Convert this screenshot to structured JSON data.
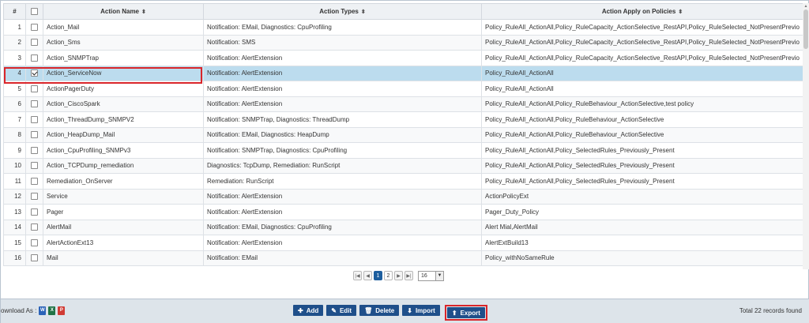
{
  "table": {
    "headers": {
      "index": "#",
      "name": "Action Name",
      "types": "Action Types",
      "policies": "Action Apply on Policies"
    },
    "rows": [
      {
        "n": "1",
        "name": "Action_Mail",
        "types": "Notification: EMail, Diagnostics: CpuProfiling",
        "policies": "Policy_RuleAll_ActionAll,Policy_RuleCapacity_ActionSelective_RestAPI,Policy_RuleSelected_NotPresentPrevio",
        "checked": false
      },
      {
        "n": "2",
        "name": "Action_Sms",
        "types": "Notification: SMS",
        "policies": "Policy_RuleAll_ActionAll,Policy_RuleCapacity_ActionSelective_RestAPI,Policy_RuleSelected_NotPresentPrevio",
        "checked": false
      },
      {
        "n": "3",
        "name": "Action_SNMPTrap",
        "types": "Notification: AlertExtension",
        "policies": "Policy_RuleAll_ActionAll,Policy_RuleCapacity_ActionSelective_RestAPI,Policy_RuleSelected_NotPresentPrevio",
        "checked": false
      },
      {
        "n": "4",
        "name": "Action_ServiceNow",
        "types": "Notification: AlertExtension",
        "policies": "Policy_RuleAll_ActionAll",
        "checked": true
      },
      {
        "n": "5",
        "name": "ActionPagerDuty",
        "types": "Notification: AlertExtension",
        "policies": "Policy_RuleAll_ActionAll",
        "checked": false
      },
      {
        "n": "6",
        "name": "Action_CiscoSpark",
        "types": "Notification: AlertExtension",
        "policies": "Policy_RuleAll_ActionAll,Policy_RuleBehaviour_ActionSelective,test policy",
        "checked": false
      },
      {
        "n": "7",
        "name": "Action_ThreadDump_SNMPV2",
        "types": "Notification: SNMPTrap, Diagnostics: ThreadDump",
        "policies": "Policy_RuleAll_ActionAll,Policy_RuleBehaviour_ActionSelective",
        "checked": false
      },
      {
        "n": "8",
        "name": "Action_HeapDump_Mail",
        "types": "Notification: EMail, Diagnostics: HeapDump",
        "policies": "Policy_RuleAll_ActionAll,Policy_RuleBehaviour_ActionSelective",
        "checked": false
      },
      {
        "n": "9",
        "name": "Action_CpuProfiling_SNMPv3",
        "types": "Notification: SNMPTrap, Diagnostics: CpuProfiling",
        "policies": "Policy_RuleAll_ActionAll,Policy_SelectedRules_Previously_Present",
        "checked": false
      },
      {
        "n": "10",
        "name": "Action_TCPDump_remediation",
        "types": "Diagnostics: TcpDump, Remediation: RunScript",
        "policies": "Policy_RuleAll_ActionAll,Policy_SelectedRules_Previously_Present",
        "checked": false
      },
      {
        "n": "11",
        "name": "Remediation_OnServer",
        "types": "Remediation: RunScript",
        "policies": "Policy_RuleAll_ActionAll,Policy_SelectedRules_Previously_Present",
        "checked": false
      },
      {
        "n": "12",
        "name": "Service",
        "types": "Notification: AlertExtension",
        "policies": "ActionPolicyExt",
        "checked": false
      },
      {
        "n": "13",
        "name": "Pager",
        "types": "Notification: AlertExtension",
        "policies": "Pager_Duty_Policy",
        "checked": false
      },
      {
        "n": "14",
        "name": "AlertMail",
        "types": "Notification: EMail, Diagnostics: CpuProfiling",
        "policies": "Alert Mial,AlertMail",
        "checked": false
      },
      {
        "n": "15",
        "name": "AlertActionExt13",
        "types": "Notification: AlertExtension",
        "policies": "AlertExtBuild13",
        "checked": false
      },
      {
        "n": "16",
        "name": "Mail",
        "types": "Notification: EMail",
        "policies": "Policy_withNoSameRule",
        "checked": false
      }
    ]
  },
  "pager": {
    "pages": [
      "1",
      "2"
    ],
    "active_page": "1",
    "page_size": "16"
  },
  "footer": {
    "download_label": "ownload As :",
    "total_text": "Total 22 records found",
    "buttons": {
      "add": "Add",
      "edit": "Edit",
      "delete": "Delete",
      "import": "Import",
      "export": "Export"
    }
  },
  "colors": {
    "selected_row": "#bcdcee",
    "button_bg": "#1f4f8a",
    "highlight": "#d9252a",
    "footer_bg": "#dde4ea"
  }
}
